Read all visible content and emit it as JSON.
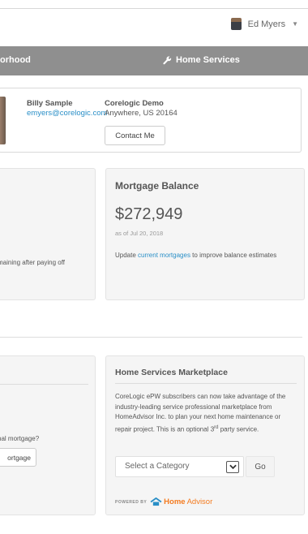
{
  "header": {
    "user_name": "Ed Myers",
    "user_caret": "▼"
  },
  "nav": {
    "left_partial": "orhood",
    "home_services": "Home Services",
    "home_services_icon": "wrench-icon"
  },
  "agent": {
    "name": "Billy Sample",
    "email": "emyers@corelogic.com",
    "company": "Corelogic Demo",
    "address": "Anywhere, US 20164",
    "contact_label": "Contact Me"
  },
  "left_card_top": {
    "partial_text": "maining after paying off"
  },
  "mortgage_balance": {
    "title": "Mortgage Balance",
    "amount": "$272,949",
    "as_of": "as of Jul 20, 2018",
    "note_prefix": "Update ",
    "note_link": "current mortgages",
    "note_suffix": " to improve balance estimates"
  },
  "left_card_bottom": {
    "question_partial": "nal mortgage?",
    "button_partial": "ortgage"
  },
  "home_services_marketplace": {
    "title": "Home Services Marketplace",
    "description": "CoreLogic ePW subscribers can now take advantage of the industry-leading service professional marketplace from HomeAdvisor Inc. to plan your next home maintenance or repair project. This is an optional 3",
    "description_sup": "rd",
    "description_end": " party service.",
    "select_value": "Select a Category",
    "go_label": "Go",
    "powered_by": "POWERED BY",
    "brand_home": "Home",
    "brand_advisor": "Advisor"
  },
  "colors": {
    "nav_bg": "#8f8f8f",
    "link": "#2a8fc7",
    "brand": "#f47b20"
  }
}
